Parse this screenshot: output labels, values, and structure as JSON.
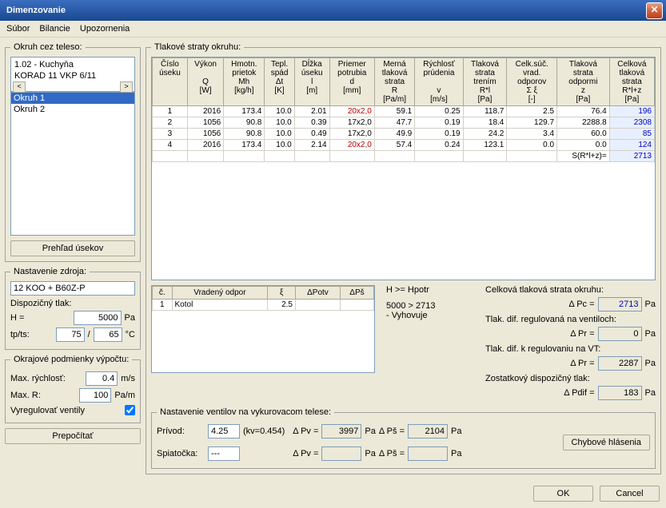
{
  "app": {
    "title": "Dimenzovanie"
  },
  "menu": {
    "subor": "Súbor",
    "bilancie": "Bilancie",
    "upozornenia": "Upozornenia"
  },
  "okruh_teleso": {
    "legend": "Okruh cez teleso:",
    "line1": "1.02 - Kuchyňa",
    "line2": "KORAD 11 VKP 6/11",
    "items": [
      "Okruh 1",
      "Okruh 2"
    ],
    "prehlad": "Prehľad úsekov"
  },
  "zdroj": {
    "legend": "Nastavenie zdroja:",
    "value": "12 KOO + B60Z-P",
    "disp_tlak": "Dispozičný tlak:",
    "h_lbl": "H =",
    "h_val": "5000",
    "h_unit": "Pa",
    "tp_lbl": "tp/ts:",
    "tp_val": "75",
    "sep": "/",
    "ts_val": "65",
    "tp_unit": "°C"
  },
  "okraj": {
    "legend": "Okrajové podmienky výpočtu:",
    "maxr_lbl": "Max. rýchlosť:",
    "maxr_val": "0.4",
    "maxr_unit": "m/s",
    "maxR_lbl": "Max. R:",
    "maxR_val": "100",
    "maxR_unit": "Pa/m",
    "vyreg_lbl": "Vyregulovať ventily",
    "prepocitat": "Prepočítať"
  },
  "straty": {
    "legend": "Tlakové straty okruhu:",
    "headers": [
      "Číslo<br>úseku",
      "Výkon<br><br>Q<br>[W]",
      "Hmotn.<br>prietok<br>Mh<br>[kg/h]",
      "Tepl.<br>spád<br>Δt<br>[K]",
      "Dĺžka<br>úseku<br>l<br>[m]",
      "Priemer<br>potrubia<br>d<br>[mm]",
      "Merná<br>tlaková<br>strata<br>R<br>[Pa/m]",
      "Rýchlosť<br>prúdenia<br><br>v<br>[m/s]",
      "Tlaková<br>strata<br>trením<br>R*l<br>[Pa]",
      "Celk.súč.<br>vrad.<br>odporov<br>Σ ξ<br>[-]",
      "Tlaková<br>strata<br>odpormi<br>z<br>[Pa]",
      "Celková<br>tlaková<br>strata<br>R*l+z<br>[Pa]"
    ],
    "rows": [
      {
        "n": "1",
        "q": "2016",
        "mh": "173.4",
        "dt": "10.0",
        "l": "2.01",
        "d": "20x2,0",
        "r": "59.1",
        "v": "0.25",
        "rl": "118.7",
        "se": "2.5",
        "z": "76.4",
        "tot": "196",
        "dred": true
      },
      {
        "n": "2",
        "q": "1056",
        "mh": "90.8",
        "dt": "10.0",
        "l": "0.39",
        "d": "17x2,0",
        "r": "47.7",
        "v": "0.19",
        "rl": "18.4",
        "se": "129.7",
        "z": "2288.8",
        "tot": "2308",
        "dred": false
      },
      {
        "n": "3",
        "q": "1056",
        "mh": "90.8",
        "dt": "10.0",
        "l": "0.49",
        "d": "17x2,0",
        "r": "49.9",
        "v": "0.19",
        "rl": "24.2",
        "se": "3.4",
        "z": "60.0",
        "tot": "85",
        "dred": false
      },
      {
        "n": "4",
        "q": "2016",
        "mh": "173.4",
        "dt": "10.0",
        "l": "2.14",
        "d": "20x2,0",
        "r": "57.4",
        "v": "0.24",
        "rl": "123.1",
        "se": "0.0",
        "z": "0.0",
        "tot": "124",
        "dred": true
      }
    ],
    "sum_lbl": "S(R*l+z)=",
    "sum_val": "2713"
  },
  "vradeny": {
    "h1": "č.",
    "h2": "Vradený odpor",
    "h3": "ξ",
    "h4": "ΔPotv",
    "h5": "ΔPš",
    "r1": {
      "n": "1",
      "name": "Kotol",
      "xi": "2.5",
      "potv": "",
      "ps": ""
    }
  },
  "info": {
    "h_lbl": "H  >=  Hpotr",
    "cmp": "5000 > 2713",
    "vyh": "- Vyhovuje"
  },
  "results": {
    "title": "Celková tlaková strata okruhu:",
    "pc_lbl": "Δ Pc =",
    "pc_val": "2713",
    "pa": "Pa",
    "reg_t": "Tlak. dif. regulovaná na ventiloch:",
    "pr_lbl": "Δ Pr =",
    "pr_val": "0",
    "vt_t": "Tlak. dif. k regulovaniu na VT:",
    "pr2_val": "2287",
    "zos_t": "Zostatkový dispozičný tlak:",
    "pdif_lbl": "Δ Pdif =",
    "pdif_val": "183"
  },
  "ventily": {
    "legend": "Nastavenie ventilov na vykurovacom telese:",
    "prvod": "Prívod:",
    "prvod_val": "4.25",
    "kv": "(kv=0.454)",
    "spiat": "Spiatočka:",
    "spiat_val": "---",
    "pv_lbl": "Δ Pv =",
    "pv1": "3997",
    "ps_lbl": "Δ Pš =",
    "ps1": "2104",
    "pa": "Pa",
    "pv2": "",
    "ps2": "",
    "chyb": "Chybové hlásenia"
  },
  "btns": {
    "ok": "OK",
    "cancel": "Cancel"
  }
}
